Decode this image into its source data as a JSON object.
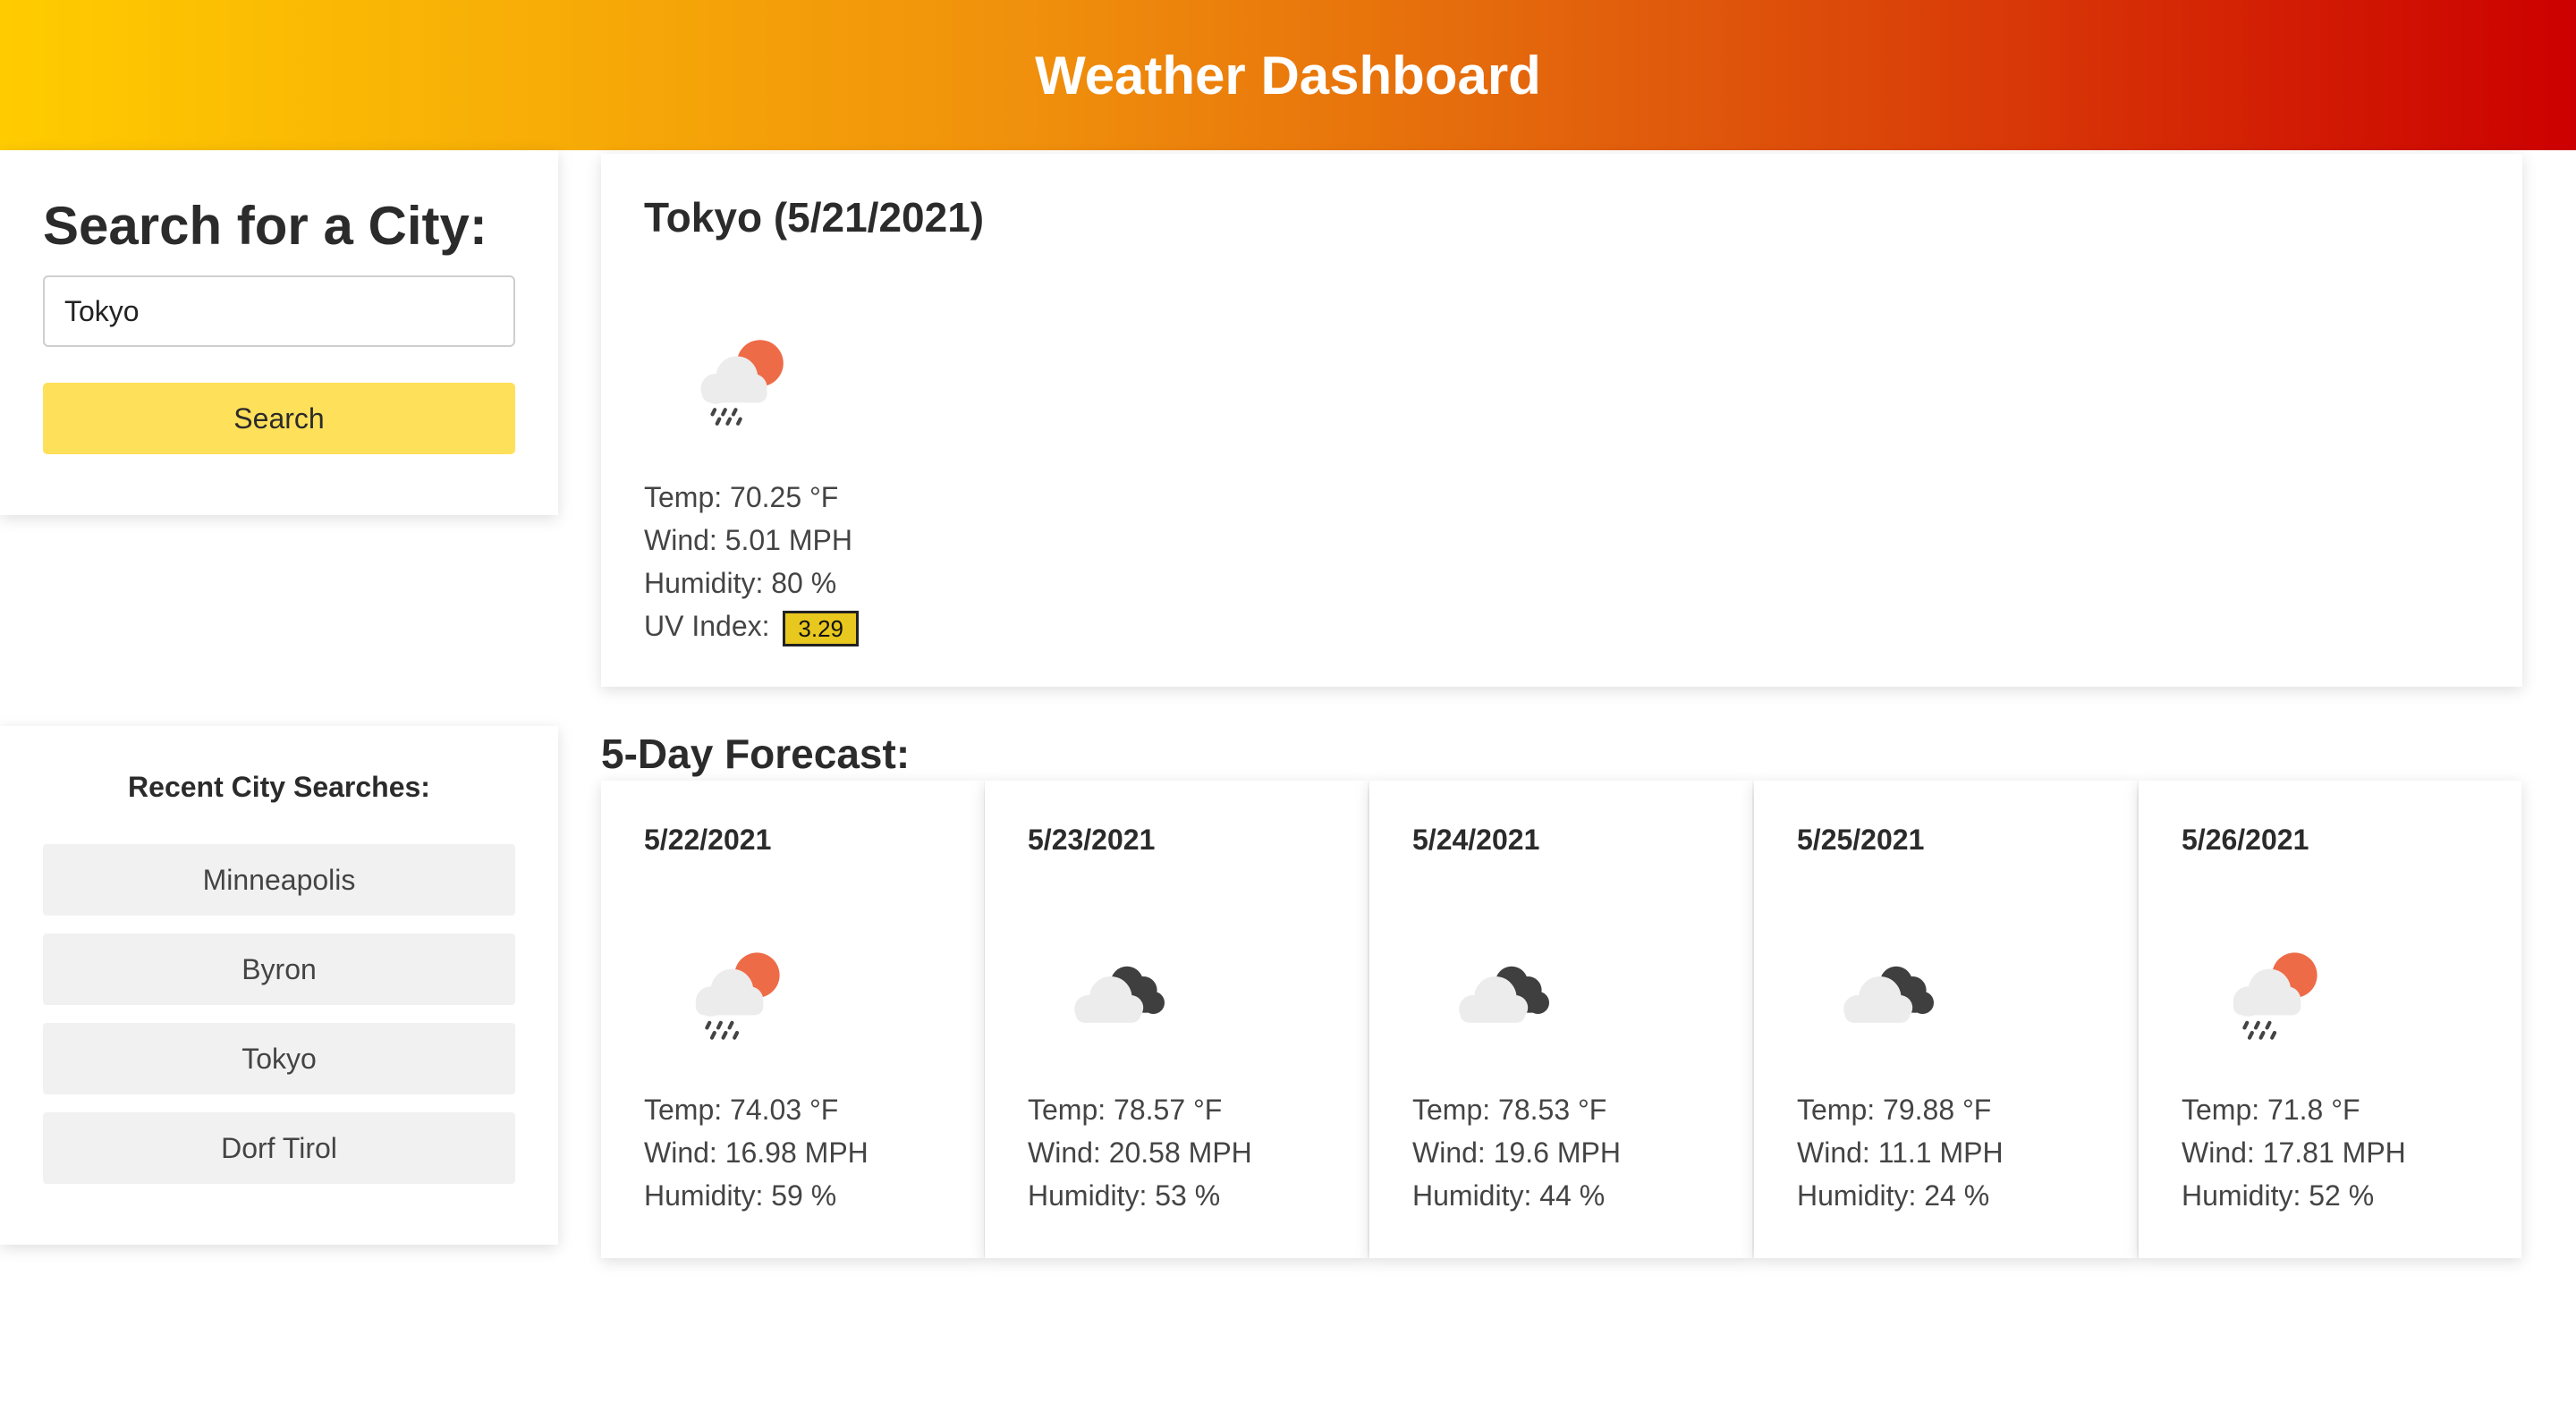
{
  "header": {
    "title": "Weather Dashboard"
  },
  "search": {
    "title": "Search for a City:",
    "input_value": "Tokyo",
    "button_label": "Search"
  },
  "recent": {
    "title": "Recent City Searches:",
    "items": [
      "Minneapolis",
      "Byron",
      "Tokyo",
      "Dorf Tirol"
    ]
  },
  "current": {
    "title": "Tokyo (5/21/2021)",
    "icon": "sun-cloud-rain-icon",
    "temp": "Temp: 70.25 °F",
    "wind": "Wind: 5.01 MPH",
    "humidity": "Humidity: 80 %",
    "uv_label": "UV Index:",
    "uv_value": "3.29",
    "uv_color": "#e8c81e"
  },
  "forecast": {
    "title": "5-Day Forecast:",
    "days": [
      {
        "date": "5/22/2021",
        "icon": "sun-cloud-rain-icon",
        "temp": "Temp: 74.03 °F",
        "wind": "Wind: 16.98 MPH",
        "humidity": "Humidity: 59 %"
      },
      {
        "date": "5/23/2021",
        "icon": "broken-clouds-icon",
        "temp": "Temp: 78.57 °F",
        "wind": "Wind: 20.58 MPH",
        "humidity": "Humidity: 53 %"
      },
      {
        "date": "5/24/2021",
        "icon": "broken-clouds-icon",
        "temp": "Temp: 78.53 °F",
        "wind": "Wind: 19.6 MPH",
        "humidity": "Humidity: 44 %"
      },
      {
        "date": "5/25/2021",
        "icon": "broken-clouds-icon",
        "temp": "Temp: 79.88 °F",
        "wind": "Wind: 11.1 MPH",
        "humidity": "Humidity: 24 %"
      },
      {
        "date": "5/26/2021",
        "icon": "sun-cloud-rain-icon",
        "temp": "Temp: 71.8 °F",
        "wind": "Wind: 17.81 MPH",
        "humidity": "Humidity: 52 %"
      }
    ]
  },
  "colors": {
    "header_gradient": [
      "#ffcc00",
      "#f0900c",
      "#e05a0c",
      "#cc0000"
    ],
    "search_button": "#ffe05a",
    "sun": "#ee6b47",
    "dark_cloud": "#3f3f3f",
    "light_cloud": "#ececec"
  }
}
